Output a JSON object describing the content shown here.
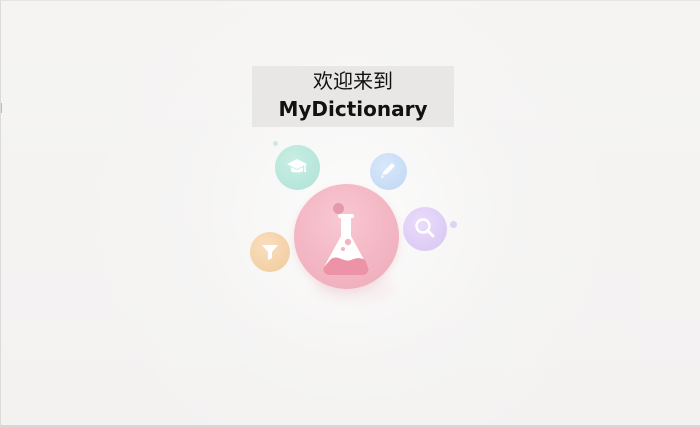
{
  "welcome": {
    "greeting": "欢迎来到",
    "app_name": "MyDictionary"
  },
  "illustration": {
    "center_icon": "flask-icon",
    "orbit_icons": [
      "graduation-cap-icon",
      "pen-icon",
      "search-icon",
      "filter-icon"
    ]
  },
  "colors": {
    "background": "#f4f3f2",
    "welcome_box": "#e8e7e6",
    "main_bubble": "#f3b6c3",
    "flask_fill": "#ec93a8",
    "cap_bubble": "#aee2d5",
    "pen_bubble": "#bfd6f2",
    "search_bubble": "#d7c5f2",
    "filter_bubble": "#f1c99c"
  }
}
